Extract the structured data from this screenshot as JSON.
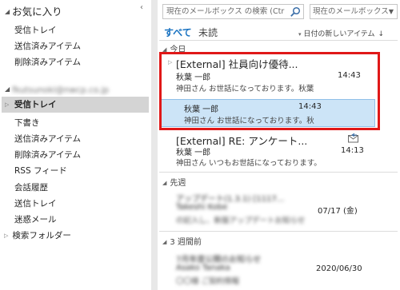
{
  "nav": {
    "favorites_header": "お気に入り",
    "favorites": [
      "受信トレイ",
      "送信済みアイテム",
      "削除済みアイテム"
    ],
    "account_header": "fkutsunoki@nwcp.co.jp",
    "account_items": [
      {
        "label": "受信トレイ",
        "selected": true,
        "collapsible": true
      },
      {
        "label": "下書き"
      },
      {
        "label": "送信済みアイテム"
      },
      {
        "label": "削除済みアイテム"
      },
      {
        "label": "RSS フィード"
      },
      {
        "label": "会話履歴"
      },
      {
        "label": "送信トレイ"
      },
      {
        "label": "迷惑メール"
      },
      {
        "label": "検索フォルダー",
        "collapsible": true
      }
    ]
  },
  "search": {
    "placeholder": "現在のメールボックス の検索 (Ctrl...",
    "scope": "現在のメールボックス"
  },
  "filters": {
    "all": "すべて",
    "unread": "未読",
    "sort": "日付の新しいアイテム"
  },
  "groups": {
    "today": "今日",
    "last_week": "先週",
    "three_weeks_ago": "3 週間前"
  },
  "messages": [
    {
      "subject": "[External] 社員向け優待...",
      "sender": "秋葉 一郎",
      "time": "14:43",
      "preview": "神田さん お世話になっております。秋葉"
    },
    {
      "sender": "秋葉 一郎",
      "time": "14:43",
      "preview": "神田さん お世話になっております。秋"
    },
    {
      "subject": "[External] RE: アンケート...",
      "sender": "秋葉 一郎",
      "time": "14:13",
      "preview": "神田さん いつもお世話になっております。"
    },
    {
      "subject": "アップデート(1.3.1) [1117...",
      "sender": "Takeshi Kobe",
      "time": "07/17 (金)",
      "preview": "の記入し、新版アップデートお知らせ"
    },
    {
      "subject": "7月年度公開のお知らせ",
      "sender": "Asako Tanaka",
      "time": "2020/06/30",
      "preview": "〇〇様 ご契約情報"
    }
  ],
  "colors": {
    "accent": "#1570c0",
    "highlight_frame": "#e01818",
    "selected_row": "#cce4f7",
    "nav_selected": "#d4d4d4"
  }
}
